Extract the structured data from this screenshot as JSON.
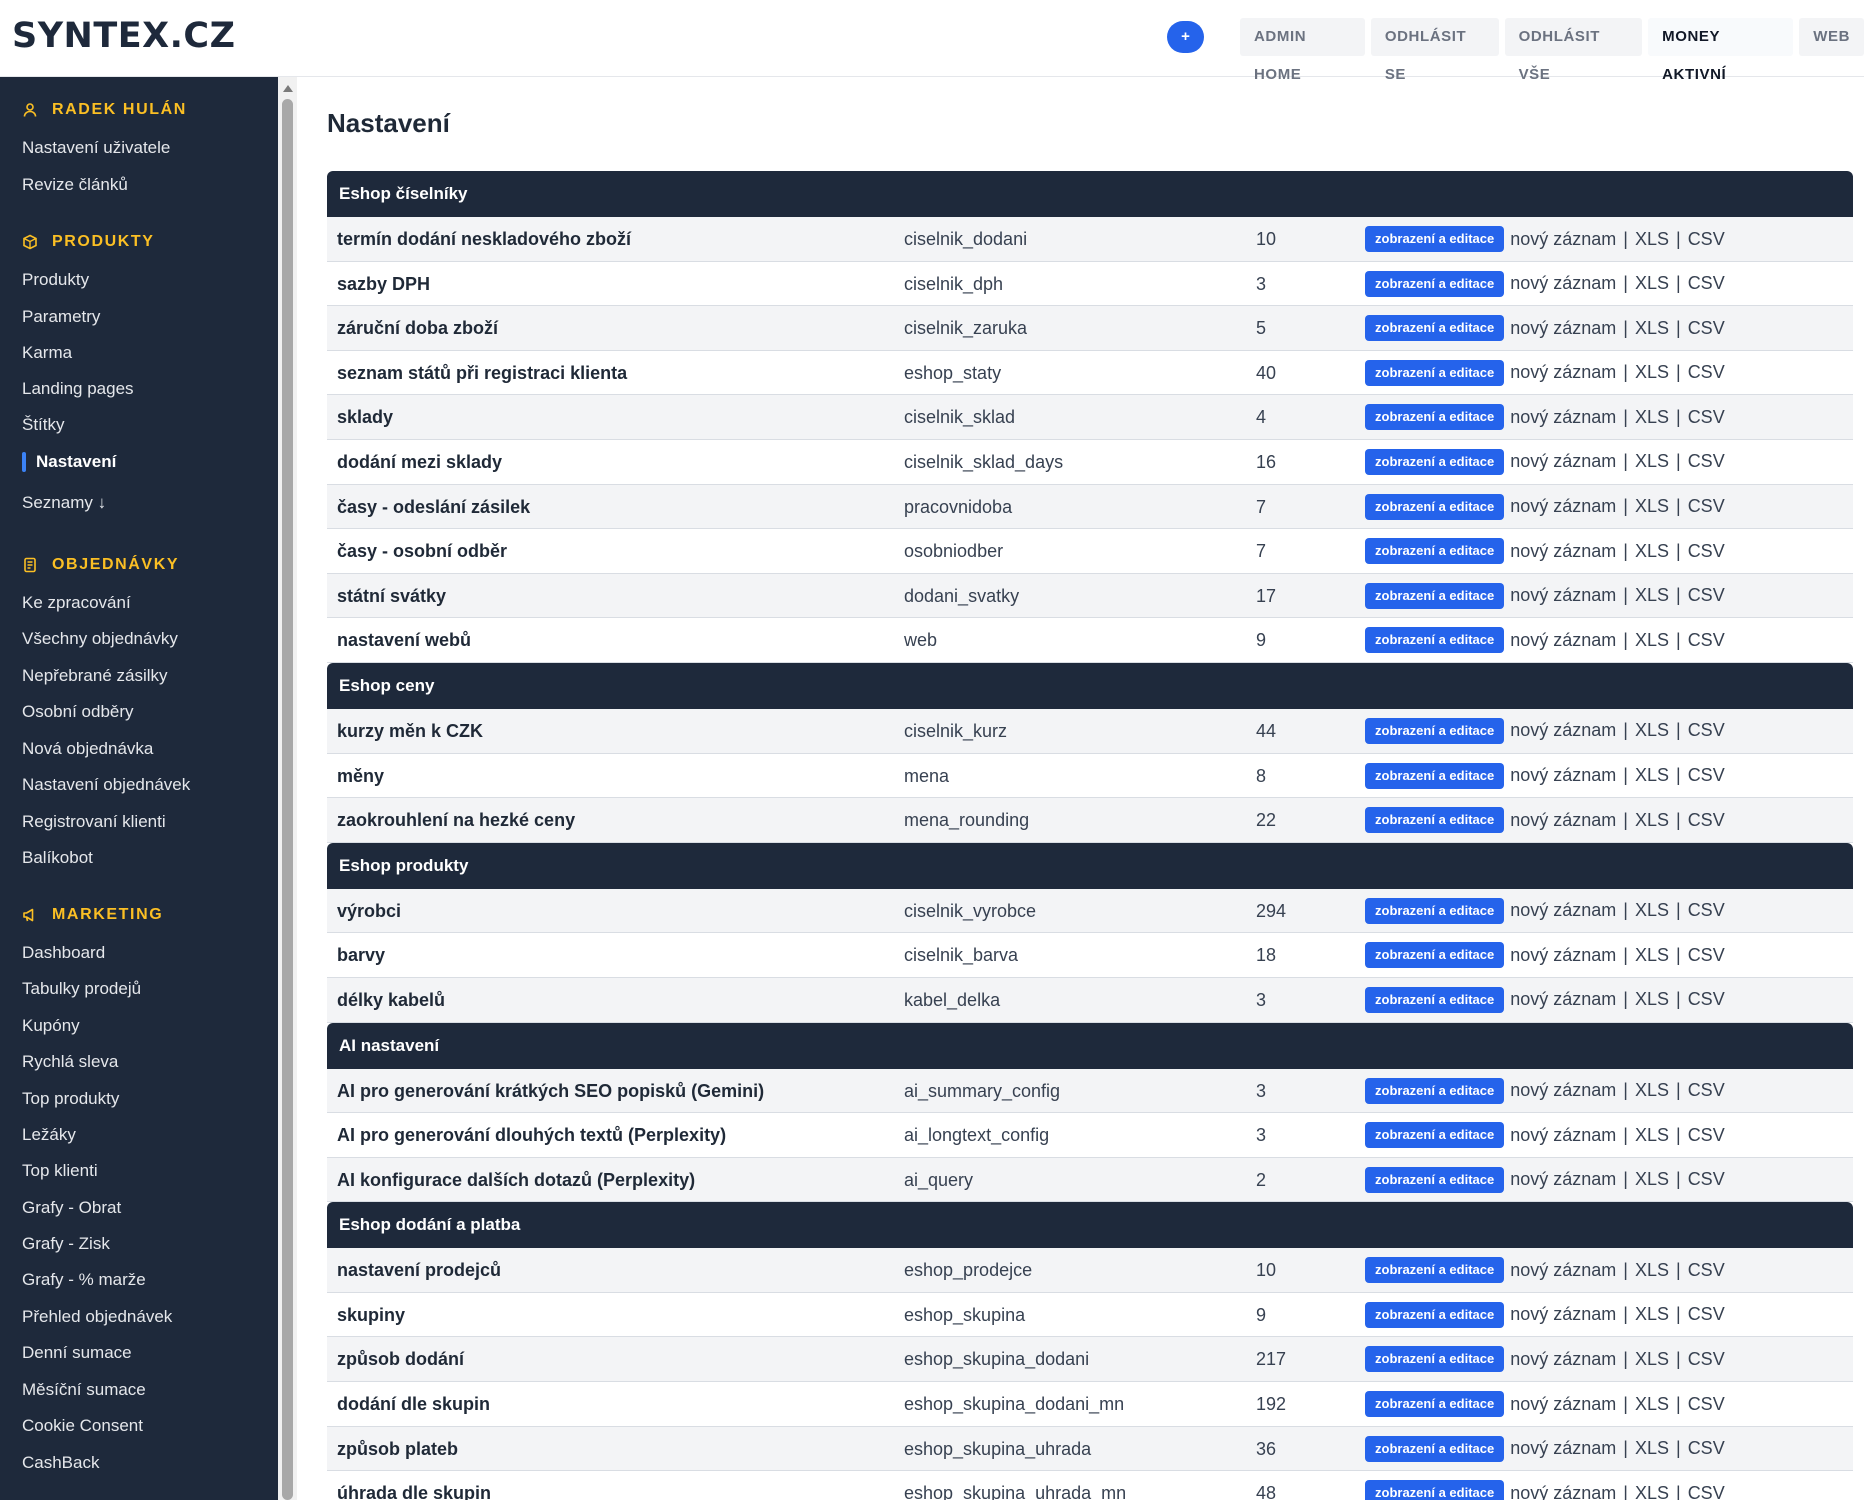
{
  "app": {
    "logo": "SYNTEX.CZ",
    "plus_label": "+",
    "topnav": [
      {
        "label": "ADMIN HOME",
        "active": false
      },
      {
        "label": "ODHLÁSIT SE",
        "active": false
      },
      {
        "label": "ODHLÁSIT VŠE",
        "active": false
      },
      {
        "label": "MONEY AKTIVNÍ",
        "active": true
      },
      {
        "label": "WEB",
        "active": false
      }
    ]
  },
  "sidebar": {
    "user": {
      "title": "RADEK HULÁN",
      "icon": "user-icon",
      "items": [
        "Nastavení uživatele",
        "Revize článků"
      ]
    },
    "produkty": {
      "title": "PRODUKTY",
      "icon": "box-icon",
      "items": [
        "Produkty",
        "Parametry",
        "Karma",
        "Landing pages",
        "Štítky",
        "Nastavení",
        "Seznamy ↓"
      ],
      "active": "Nastavení"
    },
    "objednavky": {
      "title": "OBJEDNÁVKY",
      "icon": "document-icon",
      "items": [
        "Ke zpracování",
        "Všechny objednávky",
        "Nepřebrané zásilky",
        "Osobní odběry",
        "Nová objednávka",
        "Nastavení objednávek",
        "Registrovaní klienti",
        "Balíkobot"
      ]
    },
    "marketing": {
      "title": "MARKETING",
      "icon": "megaphone-icon",
      "items": [
        "Dashboard",
        "Tabulky prodejů",
        "Kupóny",
        "Rychlá sleva",
        "Top produkty",
        "Ležáky",
        "Top klienti",
        "Grafy - Obrat",
        "Grafy - Zisk",
        "Grafy - % marže",
        "Přehled objednávek",
        "Denní sumace",
        "Měsíční sumace",
        "Cookie Consent",
        "CashBack"
      ]
    }
  },
  "main": {
    "title": "Nastavení",
    "action_labels": {
      "edit": "zobrazení a editace",
      "new": "nový záznam",
      "xls": "XLS",
      "csv": "CSV",
      "sep": "|"
    },
    "groups": [
      {
        "title": "Eshop číselníky",
        "rows": [
          {
            "name": "termín dodání neskladového zboží",
            "table": "ciselnik_dodani",
            "count": "10"
          },
          {
            "name": "sazby DPH",
            "table": "ciselnik_dph",
            "count": "3"
          },
          {
            "name": "záruční doba zboží",
            "table": "ciselnik_zaruka",
            "count": "5"
          },
          {
            "name": "seznam států při registraci klienta",
            "table": "eshop_staty",
            "count": "40"
          },
          {
            "name": "sklady",
            "table": "ciselnik_sklad",
            "count": "4"
          },
          {
            "name": "dodání mezi sklady",
            "table": "ciselnik_sklad_days",
            "count": "16"
          },
          {
            "name": "časy - odeslání zásilek",
            "table": "pracovnidoba",
            "count": "7"
          },
          {
            "name": "časy - osobní odběr",
            "table": "osobniodber",
            "count": "7"
          },
          {
            "name": "státní svátky",
            "table": "dodani_svatky",
            "count": "17"
          },
          {
            "name": "nastavení webů",
            "table": "web",
            "count": "9"
          }
        ]
      },
      {
        "title": "Eshop ceny",
        "rows": [
          {
            "name": "kurzy měn k CZK",
            "table": "ciselnik_kurz",
            "count": "44"
          },
          {
            "name": "měny",
            "table": "mena",
            "count": "8"
          },
          {
            "name": "zaokrouhlení na hezké ceny",
            "table": "mena_rounding",
            "count": "22"
          }
        ]
      },
      {
        "title": "Eshop produkty",
        "rows": [
          {
            "name": "výrobci",
            "table": "ciselnik_vyrobce",
            "count": "294"
          },
          {
            "name": "barvy",
            "table": "ciselnik_barva",
            "count": "18"
          },
          {
            "name": "délky kabelů",
            "table": "kabel_delka",
            "count": "3"
          }
        ]
      },
      {
        "title": "AI nastavení",
        "rows": [
          {
            "name": "AI pro generování krátkých SEO popisků (Gemini)",
            "table": "ai_summary_config",
            "count": "3"
          },
          {
            "name": "AI pro generování dlouhých textů (Perplexity)",
            "table": "ai_longtext_config",
            "count": "3"
          },
          {
            "name": "AI konfigurace dalších dotazů (Perplexity)",
            "table": "ai_query",
            "count": "2"
          }
        ]
      },
      {
        "title": "Eshop dodání a platba",
        "rows": [
          {
            "name": "nastavení prodejců",
            "table": "eshop_prodejce",
            "count": "10"
          },
          {
            "name": "skupiny",
            "table": "eshop_skupina",
            "count": "9"
          },
          {
            "name": "způsob dodání",
            "table": "eshop_skupina_dodani",
            "count": "217"
          },
          {
            "name": "dodání dle skupin",
            "table": "eshop_skupina_dodani_mn",
            "count": "192"
          },
          {
            "name": "způsob plateb",
            "table": "eshop_skupina_uhrada",
            "count": "36"
          },
          {
            "name": "úhrada dle skupin",
            "table": "eshop_skupina_uhrada_mn",
            "count": "48"
          }
        ]
      }
    ]
  },
  "colors": {
    "sidebar_bg": "#1e293b",
    "accent": "#2563eb",
    "section_title": "#fbbf24",
    "active_bar": "#3b82f6"
  }
}
